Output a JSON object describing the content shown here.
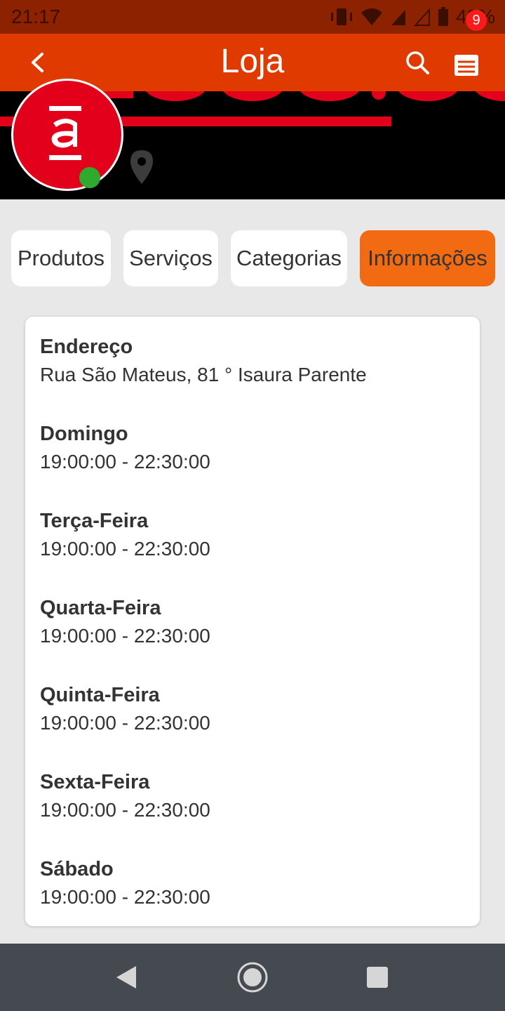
{
  "status": {
    "time": "21:17",
    "battery": "42%"
  },
  "header": {
    "title": "Loja",
    "cart_badge": "9"
  },
  "tabs": [
    {
      "label": "Produtos"
    },
    {
      "label": "Serviços"
    },
    {
      "label": "Categorias"
    },
    {
      "label": "Informações",
      "active": true
    }
  ],
  "info": {
    "address_title": "Endereço",
    "address_value": "Rua São Mateus, 81 ° Isaura Parente",
    "schedule": [
      {
        "day": "Domingo",
        "hours": "19:00:00 - 22:30:00"
      },
      {
        "day": "Terça-Feira",
        "hours": "19:00:00 - 22:30:00"
      },
      {
        "day": "Quarta-Feira",
        "hours": "19:00:00 - 22:30:00"
      },
      {
        "day": "Quinta-Feira",
        "hours": "19:00:00 - 22:30:00"
      },
      {
        "day": "Sexta-Feira",
        "hours": "19:00:00 - 22:30:00"
      },
      {
        "day": "Sábado",
        "hours": "19:00:00 - 22:30:00"
      }
    ]
  },
  "colors": {
    "accent": "#e03a00",
    "active_tab": "#f26a12",
    "brand_red": "#e3001b",
    "online": "#2eaa2e"
  }
}
